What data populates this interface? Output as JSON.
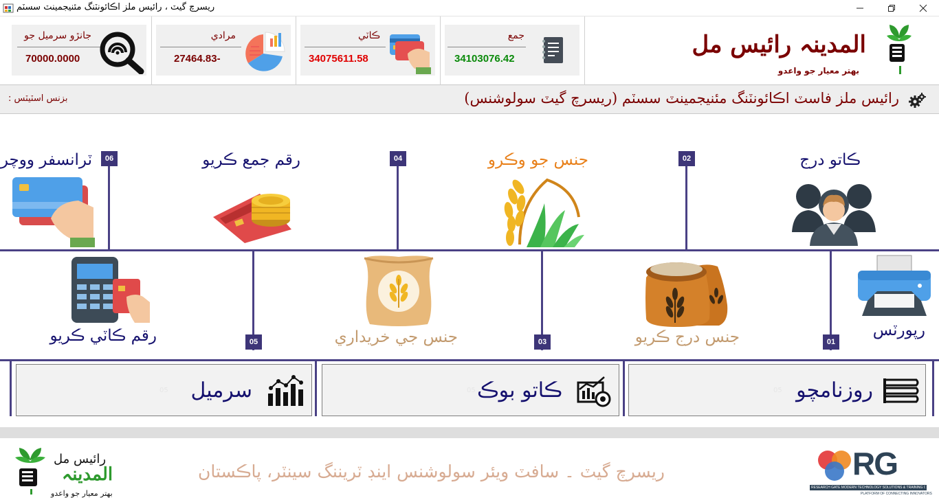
{
  "window": {
    "title": "ريسرچ گيٽ ، رائيس ملز اڪائونٽنگ مئنيجمينٽ سسٽم",
    "minimize_icon": "minimize-icon",
    "maximize_icon": "restore-icon",
    "close_icon": "close-icon"
  },
  "header": {
    "stats": [
      {
        "label": "جانڙو سرميل جو",
        "value": "70000.0000",
        "icon": "search-icon",
        "value_color": "#7a0000"
      },
      {
        "label": "مرادي",
        "value": "27464.83-",
        "icon": "pie-chart-icon",
        "value_color": "#7a0000"
      },
      {
        "label": "ڪاٽي",
        "value": "34075611.58",
        "icon": "card-payment-icon",
        "value_color": "#e00000"
      },
      {
        "label": "جمع",
        "value": "34103076.42",
        "icon": "ledger-icon",
        "value_color": "#0a8a0a"
      }
    ],
    "brand": {
      "title": "المدينہ رائيس مل",
      "subtitle": "بهتر معيار جو واعدو",
      "logo_icon": "plant-hand-logo-icon"
    }
  },
  "status": {
    "label": "بزنس اسٽيٽس :",
    "title": "رائيس ملز فاسٽ اڪائونٽنگ مئنيجمينٽ سسٽم (ريسرچ گيٽ سولوشنس)",
    "icon": "gears-icon"
  },
  "process": {
    "top_steps": [
      {
        "number": "06",
        "label": "ٽرانسفر ووچر",
        "icon": "card-in-hand-icon",
        "color": "#15116e"
      },
      {
        "number": "04",
        "label": "رقم جمع ڪريو",
        "icon": "coins-card-icon",
        "color": "#15116e"
      },
      {
        "number": "02",
        "label": "جنس جو وڪرو",
        "icon": "rice-plant-icon",
        "color": "#e8801a"
      },
      {
        "number": "",
        "label": "ڪاتو درج",
        "icon": "customers-icon",
        "color": "#15116e"
      }
    ],
    "bottom_steps": [
      {
        "number": "05",
        "label": "رقم ڪاٽي ڪريو",
        "icon": "pos-terminal-icon",
        "color": "#15116e"
      },
      {
        "number": "03",
        "label": "جنس جي خريداري",
        "icon": "grain-sack-icon",
        "color": "#c29a6e"
      },
      {
        "number": "01",
        "label": "جنس درج ڪريو",
        "icon": "wheat-sacks-icon",
        "color": "#c29a6e"
      },
      {
        "number": "",
        "label": "رپورٽس",
        "icon": "printer-icon",
        "color": "#15116e"
      }
    ]
  },
  "buttons": [
    {
      "label": "سرميل",
      "icon": "bar-chart-icon",
      "ghost": "05"
    },
    {
      "label": "ڪاتو بوڪ",
      "icon": "analytics-icon",
      "ghost": "05"
    },
    {
      "label": "روزنامچو",
      "icon": "book-stack-icon",
      "ghost": "05"
    }
  ],
  "footer": {
    "logo_name": "رائيس مل",
    "logo_title": "المدينہ",
    "logo_tagline": "بهتر معيار جو واعدو",
    "text": "ريسرچ گيٽ ۔ سافٽ ويئر سولوشنس اينڊ ٽريننگ سينٽر، پاڪستان",
    "rg_letters": "RG",
    "rg_tagline": "RESEARCH GATE MODERN TECHNOLOGY SOLUTIONS & TRAINING CENTER",
    "rg_sub": "PLATFORM OF CONNECTING INNOVATORS"
  }
}
